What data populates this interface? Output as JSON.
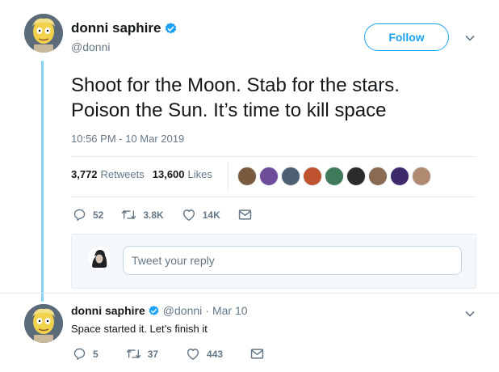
{
  "main_tweet": {
    "display_name": "donni saphire",
    "handle": "@donni",
    "follow_label": "Follow",
    "text_line1": "Shoot for the Moon. Stab for the stars.",
    "text_line2": "Poison the Sun. It’s time to kill space",
    "timestamp": "10:56 PM - 10 Mar 2019",
    "stats": {
      "retweets_count": "3,772",
      "retweets_label": "Retweets",
      "likes_count": "13,600",
      "likes_label": "Likes"
    },
    "liker_avatar_colors": [
      "#7a5a3c",
      "#6d4c9a",
      "#4d5f70",
      "#c0532f",
      "#3f7a5a",
      "#2b2b2b",
      "#8a6a50",
      "#3d2a6b",
      "#b08a70"
    ],
    "actions": {
      "reply_count": "52",
      "retweet_count": "3.8K",
      "like_count": "14K"
    }
  },
  "reply_composer": {
    "placeholder": "Tweet your reply"
  },
  "reply_tweet": {
    "display_name": "donni saphire",
    "handle": "@donni",
    "separator": "·",
    "time": "Mar 10",
    "text": "Space started it. Let’s finish it",
    "actions": {
      "reply_count": "5",
      "retweet_count": "37",
      "like_count": "443"
    }
  },
  "colors": {
    "accent": "#1da1f2",
    "thread_line": "#8ad0f5",
    "muted_text": "#657786"
  },
  "icons": [
    "verified-badge-icon",
    "chevron-down-icon",
    "reply-icon",
    "retweet-icon",
    "like-icon",
    "message-icon"
  ]
}
